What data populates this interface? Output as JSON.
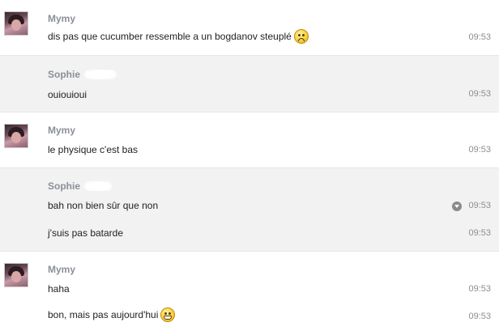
{
  "thread": {
    "groups": [
      {
        "sender": "Mymy",
        "messages": [
          {
            "text": "dis pas que cucumber ressemble a un bogdanov steuplé",
            "time": "09:53",
            "emoji": "worried-emoji"
          }
        ]
      },
      {
        "sender": "Sophie",
        "messages": [
          {
            "text": "ouiouioui",
            "time": "09:53"
          }
        ]
      },
      {
        "sender": "Mymy",
        "messages": [
          {
            "text": "le physique c'est bas",
            "time": "09:53"
          }
        ]
      },
      {
        "sender": "Sophie",
        "messages": [
          {
            "text": "bah non bien sûr que non",
            "time": "09:53",
            "menu_icon": "chevron-down-circle-icon"
          },
          {
            "text": "j'suis pas batarde",
            "time": "09:53"
          }
        ]
      },
      {
        "sender": "Mymy",
        "messages": [
          {
            "text": "haha",
            "time": "09:53"
          },
          {
            "text": "bon, mais pas aujourd'hui",
            "time": "09:53",
            "emoji": "grinning-emoji"
          }
        ]
      }
    ]
  }
}
